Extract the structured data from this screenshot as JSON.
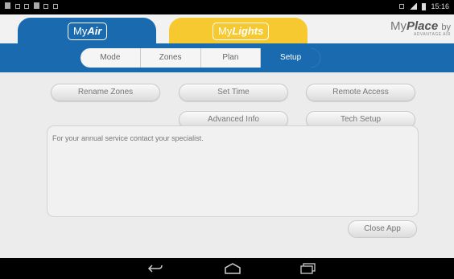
{
  "status_bar": {
    "time": "15:16",
    "left_icons": [
      "notification-icon",
      "sim-icon",
      "download-icon",
      "usb-icon",
      "image-icon",
      "check-icon"
    ],
    "right_icons": [
      "bluetooth-icon",
      "wifi-icon",
      "battery-icon"
    ]
  },
  "header": {
    "tab_myair": {
      "prefix": "My",
      "name": "Air",
      "color": "#1a6ab0"
    },
    "tab_mylights": {
      "prefix": "My",
      "name": "Lights",
      "color": "#f7c930"
    },
    "logo": {
      "line1_my": "My",
      "line1_place": "Place",
      "line1_by": "by",
      "line2": "ADVANTAGE AIR"
    }
  },
  "nav_segments": [
    {
      "label": "Mode",
      "active": false
    },
    {
      "label": "Zones",
      "active": false
    },
    {
      "label": "Plan",
      "active": false
    },
    {
      "label": "Setup",
      "active": true
    }
  ],
  "setup_buttons": {
    "rename_zones": "Rename Zones",
    "set_time": "Set Time",
    "remote_access": "Remote Access",
    "advanced_info": "Advanced Info",
    "tech_setup": "Tech Setup"
  },
  "info_panel": {
    "text": "For your annual service contact your specialist."
  },
  "close_app": "Close App",
  "android_nav": [
    "back-icon",
    "home-icon",
    "recents-icon"
  ]
}
